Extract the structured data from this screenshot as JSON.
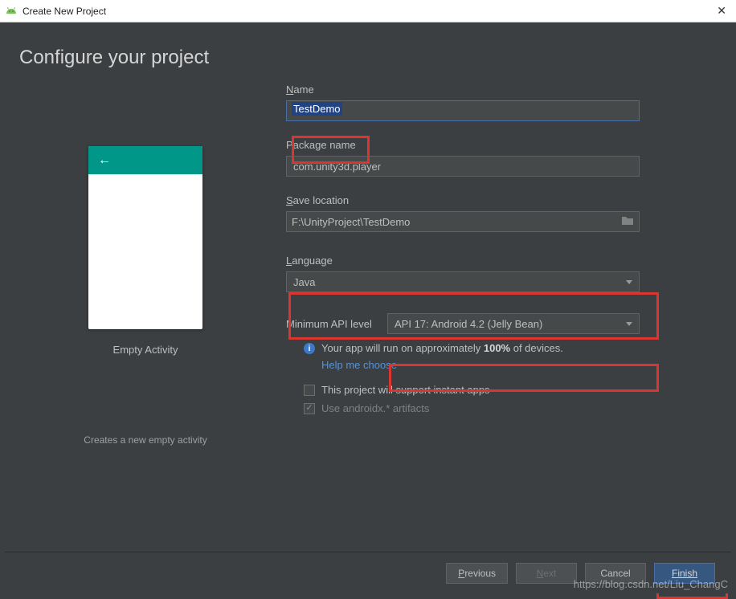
{
  "window": {
    "title": "Create New Project"
  },
  "heading": "Configure your project",
  "preview": {
    "activity_label": "Empty Activity",
    "description": "Creates a new empty activity"
  },
  "fields": {
    "name": {
      "label": "Name",
      "value": "TestDemo"
    },
    "package": {
      "label": "Package name",
      "value": "com.unity3d.player"
    },
    "location": {
      "label": "Save location",
      "value": "F:\\UnityProject\\TestDemo"
    },
    "language": {
      "label": "Language",
      "value": "Java"
    },
    "api": {
      "label": "Minimum API level",
      "value": "API 17: Android 4.2 (Jelly Bean)"
    }
  },
  "info": {
    "coverage_prefix": "Your app will run on approximately ",
    "coverage_pct": "100%",
    "coverage_suffix": " of devices.",
    "help_link": "Help me choose"
  },
  "checks": {
    "instant_apps": "This project will support instant apps",
    "androidx": "Use androidx.* artifacts"
  },
  "buttons": {
    "previous": "Previous",
    "next": "Next",
    "cancel": "Cancel",
    "finish": "Finish"
  },
  "watermark": "https://blog.csdn.net/Liu_ChangC"
}
